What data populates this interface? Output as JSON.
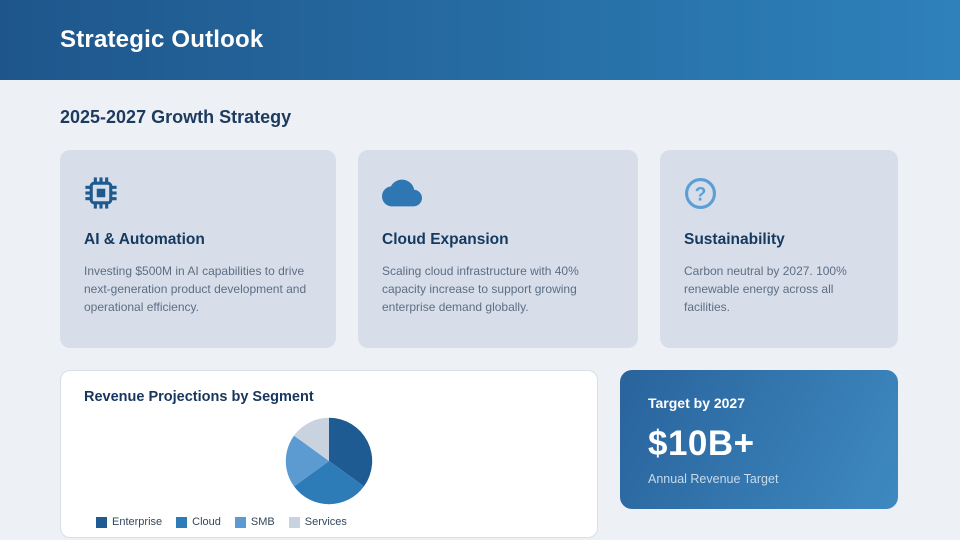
{
  "header": {
    "title": "Strategic Outlook"
  },
  "section": {
    "heading": "2025-2027 Growth Strategy"
  },
  "cards": [
    {
      "icon": "chip-icon",
      "title": "AI & Automation",
      "body": "Investing $500M in AI capabilities to drive next-generation product development and operational efficiency."
    },
    {
      "icon": "cloud-icon",
      "title": "Cloud Expansion",
      "body": "Scaling cloud infrastructure with 40% capacity increase to support growing enterprise demand globally."
    },
    {
      "icon": "question-mark-icon",
      "title": "Sustainability",
      "body": "Carbon neutral by 2027. 100% renewable energy across all facilities."
    }
  ],
  "chart_data": {
    "type": "pie",
    "title": "Revenue Projections by Segment",
    "categories": [
      "Enterprise",
      "Cloud",
      "SMB",
      "Services"
    ],
    "values": [
      35,
      30,
      20,
      15
    ],
    "unit": "percent-approx",
    "colors": [
      "#1e5b92",
      "#2e7cb7",
      "#5c9ad2",
      "#c9d3e0"
    ],
    "legend_position": "bottom-left",
    "start_angle_deg": 0,
    "direction": "clockwise"
  },
  "target": {
    "label": "Target by 2027",
    "value": "$10B+",
    "caption": "Annual Revenue Target"
  },
  "colors": {
    "header_gradient_start": "#1e568b",
    "header_gradient_end": "#2e81bb",
    "page_background": "#edf1f6",
    "card_background": "#d8dee9",
    "heading_text": "#1d3a5f",
    "body_text": "#5c6e84",
    "chip_icon": "#1d5a8f",
    "cloud_icon": "#2f77b2",
    "question_icon": "#5b9fd6",
    "target_gradient_start": "#29639c",
    "target_gradient_end": "#3e89c1"
  }
}
